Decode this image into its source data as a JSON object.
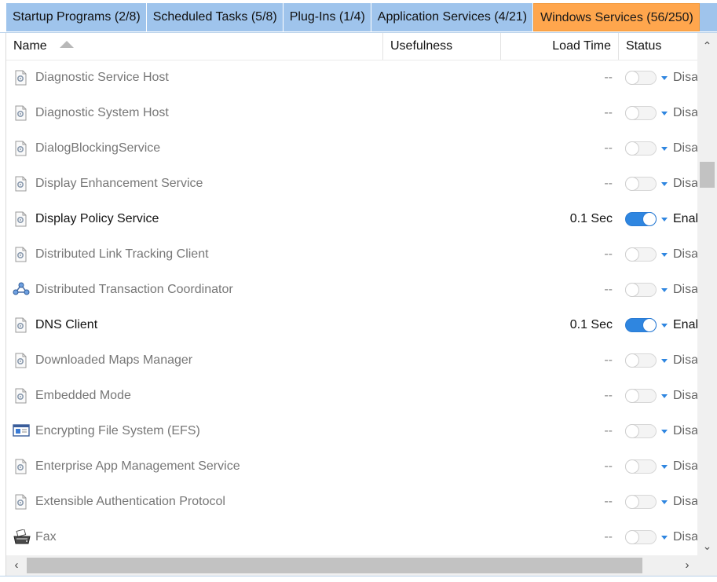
{
  "tabs": [
    {
      "label": "Startup Programs (2/8)",
      "active": false
    },
    {
      "label": "Scheduled Tasks (5/8)",
      "active": false
    },
    {
      "label": "Plug-Ins (1/4)",
      "active": false
    },
    {
      "label": "Application Services (4/21)",
      "active": false
    },
    {
      "label": "Windows Services (56/250)",
      "active": true
    }
  ],
  "columns": {
    "name": "Name",
    "usefulness": "Usefulness",
    "load_time": "Load Time",
    "status": "Status"
  },
  "rows": [
    {
      "name": "Diagnostic Service Host",
      "load": "--",
      "enabled": false,
      "status": "Disabled",
      "icon": "service-page-icon"
    },
    {
      "name": "Diagnostic System Host",
      "load": "--",
      "enabled": false,
      "status": "Disabled",
      "icon": "service-page-icon"
    },
    {
      "name": "DialogBlockingService",
      "load": "--",
      "enabled": false,
      "status": "Disabled",
      "icon": "service-page-icon"
    },
    {
      "name": "Display Enhancement Service",
      "load": "--",
      "enabled": false,
      "status": "Disabled",
      "icon": "service-page-icon"
    },
    {
      "name": "Display Policy Service",
      "load": "0.1 Sec",
      "enabled": true,
      "status": "Enabled",
      "icon": "service-page-icon"
    },
    {
      "name": "Distributed Link Tracking Client",
      "load": "--",
      "enabled": false,
      "status": "Disabled",
      "icon": "service-page-icon"
    },
    {
      "name": "Distributed Transaction Coordinator",
      "load": "--",
      "enabled": false,
      "status": "Disabled",
      "icon": "network-nodes-icon"
    },
    {
      "name": "DNS Client",
      "load": "0.1 Sec",
      "enabled": true,
      "status": "Enabled",
      "icon": "service-page-icon"
    },
    {
      "name": "Downloaded Maps Manager",
      "load": "--",
      "enabled": false,
      "status": "Disabled",
      "icon": "service-page-icon"
    },
    {
      "name": "Embedded Mode",
      "load": "--",
      "enabled": false,
      "status": "Disabled",
      "icon": "service-page-icon"
    },
    {
      "name": "Encrypting File System (EFS)",
      "load": "--",
      "enabled": false,
      "status": "Disabled",
      "icon": "window-icon"
    },
    {
      "name": "Enterprise App Management Service",
      "load": "--",
      "enabled": false,
      "status": "Disabled",
      "icon": "service-page-icon"
    },
    {
      "name": "Extensible Authentication Protocol",
      "load": "--",
      "enabled": false,
      "status": "Disabled",
      "icon": "service-page-icon"
    },
    {
      "name": "Fax",
      "load": "--",
      "enabled": false,
      "status": "Disabled",
      "icon": "fax-icon"
    }
  ],
  "colors": {
    "tab_strip": "#9fc4ec",
    "tab_active": "#ffa64d",
    "toggle_on": "#2f86e0"
  }
}
